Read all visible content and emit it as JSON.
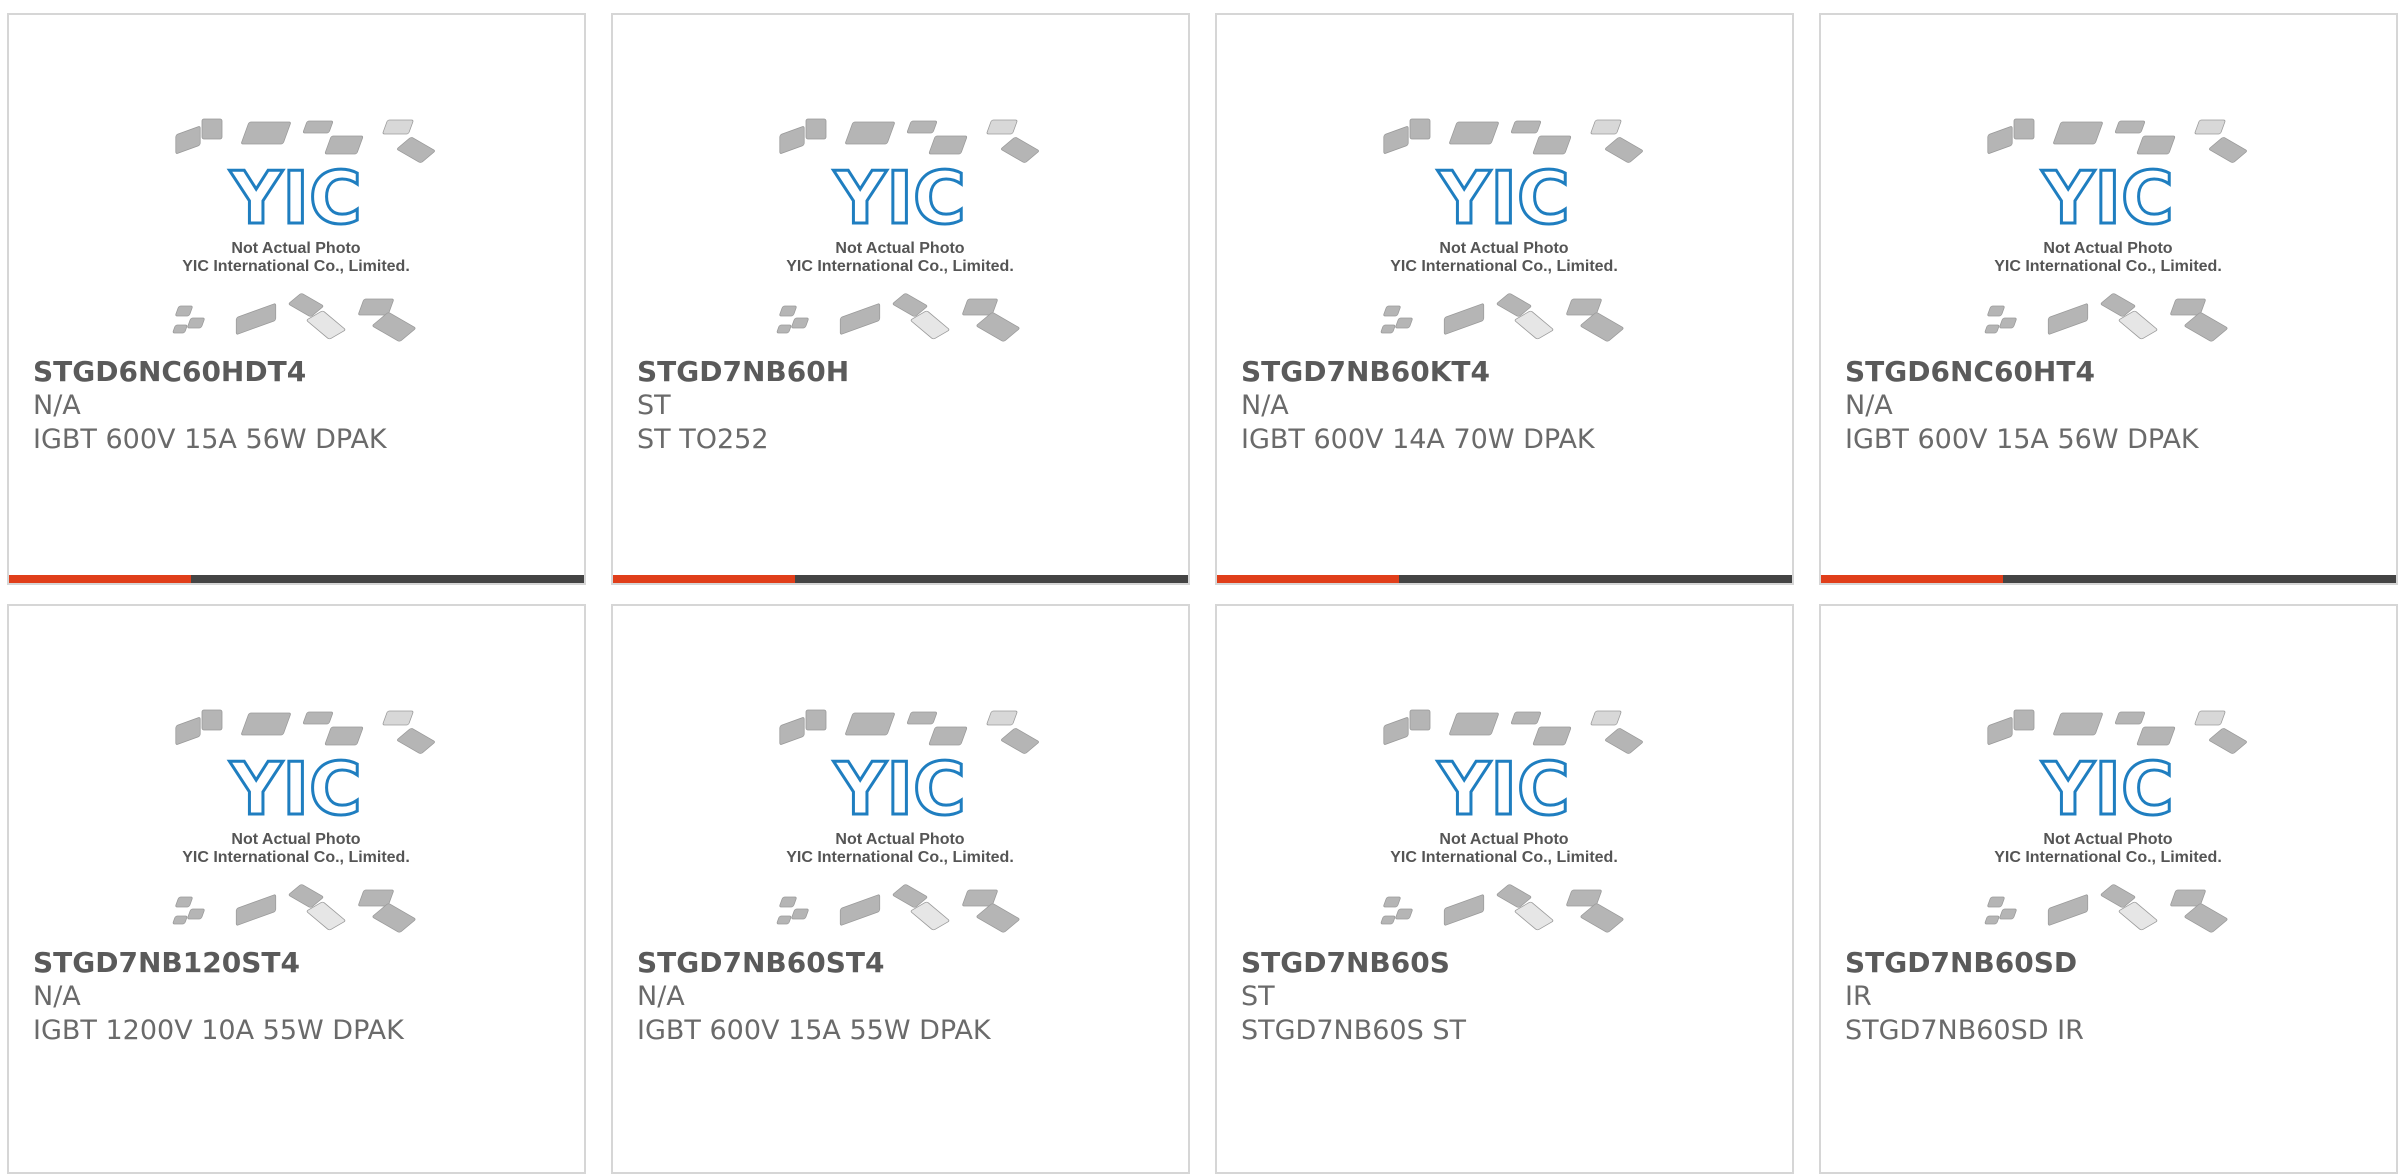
{
  "theme": {
    "accent": "#e03e1a",
    "bar": "#444444",
    "logo_blue": "#1f7ec0",
    "chip_gray": "#b5b5b5"
  },
  "placeholder": {
    "logo_text": "YIC",
    "line1": "Not Actual Photo",
    "line2": "YIC International Co., Limited."
  },
  "products": [
    {
      "part_number": "STGD6NC60HDT4",
      "manufacturer": "N/A",
      "description": "IGBT 600V 15A 56W DPAK"
    },
    {
      "part_number": "STGD7NB60H",
      "manufacturer": "ST",
      "description": "ST TO252"
    },
    {
      "part_number": "STGD7NB60KT4",
      "manufacturer": "N/A",
      "description": "IGBT 600V 14A 70W DPAK"
    },
    {
      "part_number": "STGD6NC60HT4",
      "manufacturer": "N/A",
      "description": "IGBT 600V 15A 56W DPAK"
    },
    {
      "part_number": "STGD7NB120ST4",
      "manufacturer": "N/A",
      "description": "IGBT 1200V 10A 55W DPAK"
    },
    {
      "part_number": "STGD7NB60ST4",
      "manufacturer": "N/A",
      "description": "IGBT 600V 15A 55W DPAK"
    },
    {
      "part_number": "STGD7NB60S",
      "manufacturer": "ST",
      "description": "STGD7NB60S ST"
    },
    {
      "part_number": "STGD7NB60SD",
      "manufacturer": "IR",
      "description": "STGD7NB60SD IR"
    }
  ]
}
